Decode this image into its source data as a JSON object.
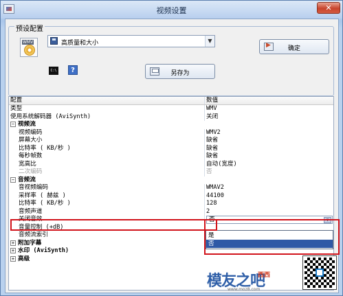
{
  "window": {
    "title": "视频设置"
  },
  "preset": {
    "group_label": "预设配置",
    "selected": "高质量和大小",
    "ok_label": "确定",
    "saveas_label": "另存为",
    "cmd_icon_text": "C:\\"
  },
  "grid": {
    "header": {
      "key": "配置",
      "value": "数值"
    },
    "rows": [
      {
        "key": "类型",
        "value": "WMV"
      },
      {
        "key": "使用系统解码器 (AviSynth)",
        "value": "关闭"
      },
      {
        "key": "视频流",
        "category": true
      },
      {
        "key": "视频编码",
        "value": "WMV2"
      },
      {
        "key": "屏幕大小",
        "value": "缺省"
      },
      {
        "key": "比特率 ( KB/秒 )",
        "value": "缺省"
      },
      {
        "key": "每秒帧数",
        "value": "缺省"
      },
      {
        "key": "宽高比",
        "value": "自动(宽度)"
      },
      {
        "key": "二次编码",
        "value": "否",
        "disabled": true
      },
      {
        "key": "音频流",
        "category": true
      },
      {
        "key": "音视频编码",
        "value": "WMAV2"
      },
      {
        "key": "采样率 ( 赫兹 )",
        "value": "44100"
      },
      {
        "key": "比特率 ( KB/秒 )",
        "value": "128"
      },
      {
        "key": "音频声道",
        "value": "2"
      },
      {
        "key": "关闭音效",
        "value": "否",
        "selected": true
      },
      {
        "key": "音量控制 (+dB)",
        "value": ""
      },
      {
        "key": "音频流索引",
        "value": ""
      },
      {
        "key": "附加字幕",
        "category": true,
        "collapsed": true
      },
      {
        "key": "水印 (AviSynth)",
        "category": true,
        "collapsed": true
      },
      {
        "key": "高级",
        "category": true,
        "collapsed": true
      }
    ],
    "dropdown_options": [
      "是",
      "否"
    ],
    "dropdown_highlighted": 1
  },
  "watermark": {
    "logo": "模友之吧",
    "small": "西西",
    "url": "www.moz8.com"
  },
  "colors": {
    "highlight": "#2f59a6",
    "annotation": "#d1131b"
  }
}
